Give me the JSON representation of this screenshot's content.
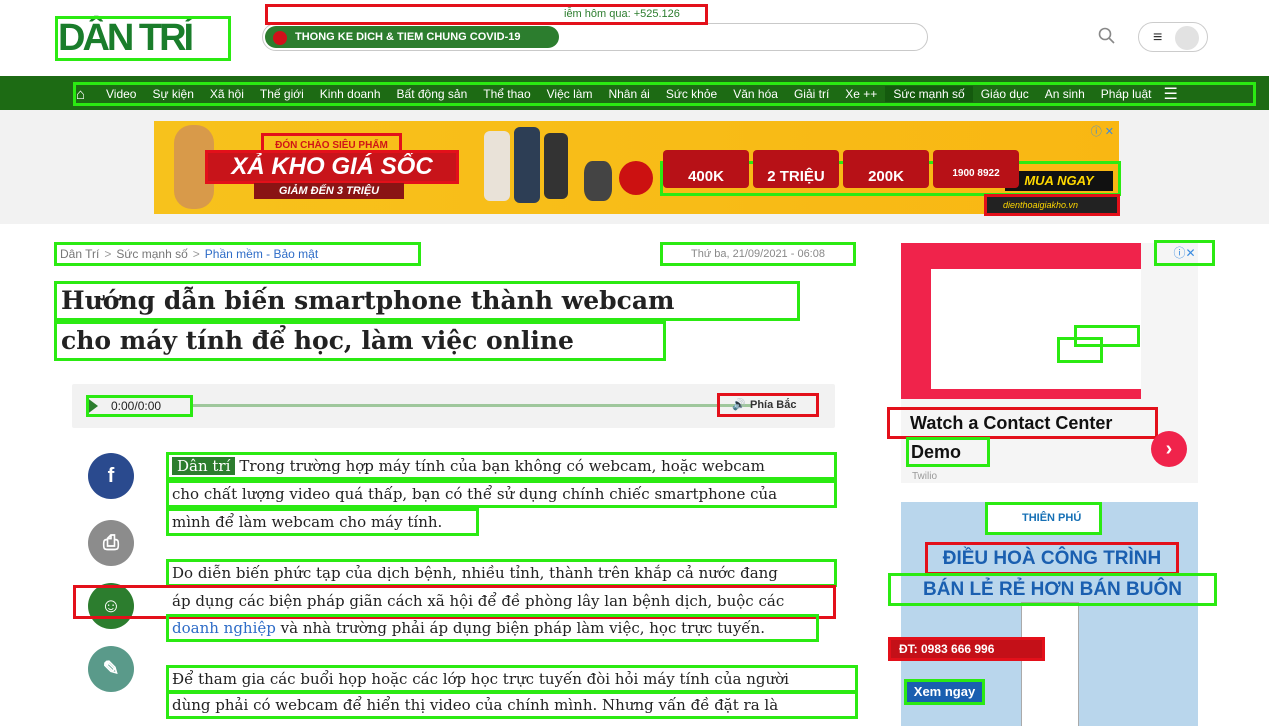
{
  "header": {
    "logo": "DÂN TRÍ",
    "ticker_label": "THONG KE DICH & TIEM CHUNG COVID-19",
    "ticker_text": "iễm hôm qua: +525.126",
    "menu_icon": "≡"
  },
  "nav": {
    "items": [
      "Video",
      "Sự kiện",
      "Xã hội",
      "Thế giới",
      "Kinh doanh",
      "Bất động sản",
      "Thể thao",
      "Việc làm",
      "Nhân ái",
      "Sức khỏe",
      "Văn hóa",
      "Giải trí",
      "Xe ++",
      "Sức mạnh số",
      "Giáo dục",
      "An sinh",
      "Pháp luật"
    ],
    "active": "Sức mạnh số"
  },
  "top_ad": {
    "sub": "ĐÓN CHÀO SIÊU PHẨM",
    "title": "XẢ KHO GIÁ SỐC",
    "tag": "GIẢM ĐẾN 3 TRIỆU",
    "promos": [
      "400K",
      "2 TRIỆU",
      "200K",
      "1900 8922"
    ],
    "cta": "MUA NGAY",
    "site": "dienthoaigiakho.vn",
    "close": "ⓘ ✕"
  },
  "article": {
    "breadcrumb": [
      "Dân Trí",
      "Sức mạnh số",
      "Phần mềm - Bảo mật"
    ],
    "date": "Thứ ba, 21/09/2021 - 06:08",
    "title_lines": [
      "Hướng dẫn biến smartphone thành webcam",
      "cho máy tính để học, làm việc online"
    ],
    "audio_time": "0:00/0:00",
    "audio_voice": "Phía Bắc",
    "source": "Dân trí",
    "p1": [
      "Trong trường hợp máy tính của bạn không có webcam, hoặc webcam",
      "cho chất lượng video quá thấp, bạn có thể sử dụng chính chiếc smartphone của",
      "mình để làm webcam cho máy tính."
    ],
    "p2": [
      "Do diễn biến phức tạp của dịch bệnh, nhiều tỉnh, thành trên khắp cả nước đang",
      "áp dụng các biện pháp giãn cách xã hội để đề phòng lây lan bệnh dịch, buộc các"
    ],
    "p2_link": "doanh nghiệp",
    "p2_tail": " và nhà trường phải áp dụng biện pháp làm việc, học trực tuyến.",
    "p3": [
      "Để tham gia các buổi họp hoặc các lớp học trực tuyến đòi hỏi máy tính của người",
      "dùng phải có webcam để hiển thị video của chính mình. Nhưng vấn đề đặt ra là"
    ]
  },
  "share": {
    "facebook": "f",
    "print": "⎙",
    "comment": "☺",
    "link": "✎"
  },
  "side_ad1": {
    "close": "ⓘ✕",
    "title1": "Watch a Contact Center",
    "title2": "Demo",
    "brand": "Twilio",
    "go": "›"
  },
  "side_ad2": {
    "logo": "THIÊN PHÚ",
    "line1": "ĐIỀU HOÀ CÔNG TRÌNH",
    "line2": "BÁN LẺ RẺ HƠN BÁN BUÔN",
    "tel": "ĐT: 0983 666 996",
    "btn": "Xem ngay"
  },
  "colors": {
    "brand_green": "#2c7d2e",
    "nav_green": "#1d6b14",
    "highlight_green": "#2bea12",
    "highlight_red": "#e3101a"
  }
}
